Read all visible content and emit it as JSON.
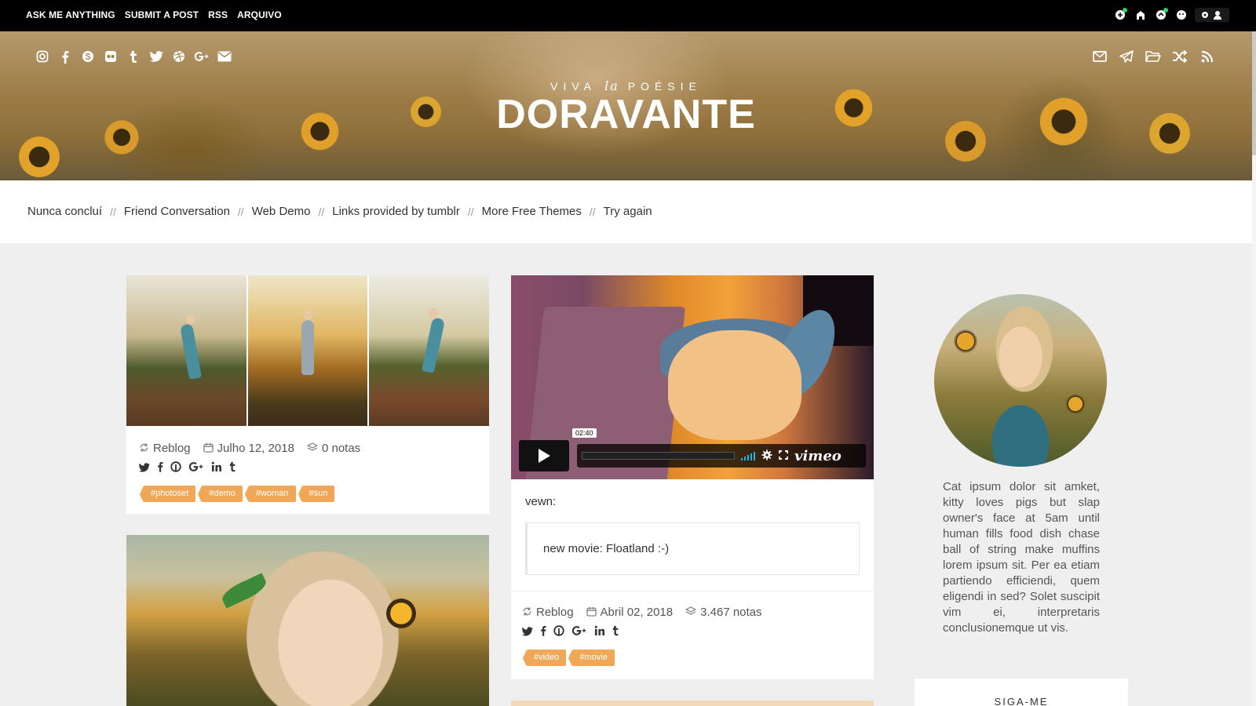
{
  "topbar": {
    "nav": [
      "ASK ME ANYTHING",
      "SUBMIT A POST",
      "RSS",
      "ARQUIVO"
    ],
    "controls": [
      "follow-icon",
      "home-icon",
      "reblog-icon",
      "like-icon",
      "settings-icon"
    ]
  },
  "header": {
    "tagline_pre": "VIVA",
    "tagline_em": "la",
    "tagline_post": "POÉSIE",
    "title": "DORAVANTE",
    "social_left": [
      "instagram-icon",
      "facebook-icon",
      "skype-icon",
      "flickr-icon",
      "tumblr-icon",
      "twitter-icon",
      "dribbble-icon",
      "google-plus-icon",
      "email-icon"
    ],
    "social_right": [
      "mail-icon",
      "send-icon",
      "folder-icon",
      "shuffle-icon",
      "rss-icon"
    ]
  },
  "links": [
    "Nunca concluí",
    "Friend Conversation",
    "Web Demo",
    "Links provided by tumblr",
    "More Free Themes",
    "Try again"
  ],
  "link_separator": "//",
  "posts": {
    "photoset": {
      "reblog": "Reblog",
      "date": "Julho 12, 2018",
      "notes": "0 notas",
      "tags": [
        "#photoset",
        "#demo",
        "#woman",
        "#sun"
      ]
    },
    "video": {
      "timecode": "02:40",
      "player_brand": "vimeo",
      "asker": "vewn:",
      "quote": "new movie: Floatland :-)",
      "reblog": "Reblog",
      "date": "Abril 02, 2018",
      "notes": "3.467 notas",
      "tags": [
        "#video",
        "#movie"
      ]
    }
  },
  "sidebar": {
    "bio": "Cat ipsum dolor sit amket, kitty loves pigs but slap owner's face at 5am until human fills food dish chase ball of string make muffins lorem ipsum sit. Per ea etiam partiendo efficiendi, quem eligendi in sed? Solet suscipit vim ei, interpretaris conclusionemque ut vis.",
    "follow_title": "SIGA-ME"
  },
  "colors": {
    "tag": "#f0a858",
    "topbar": "#000000",
    "background": "#efefef"
  }
}
